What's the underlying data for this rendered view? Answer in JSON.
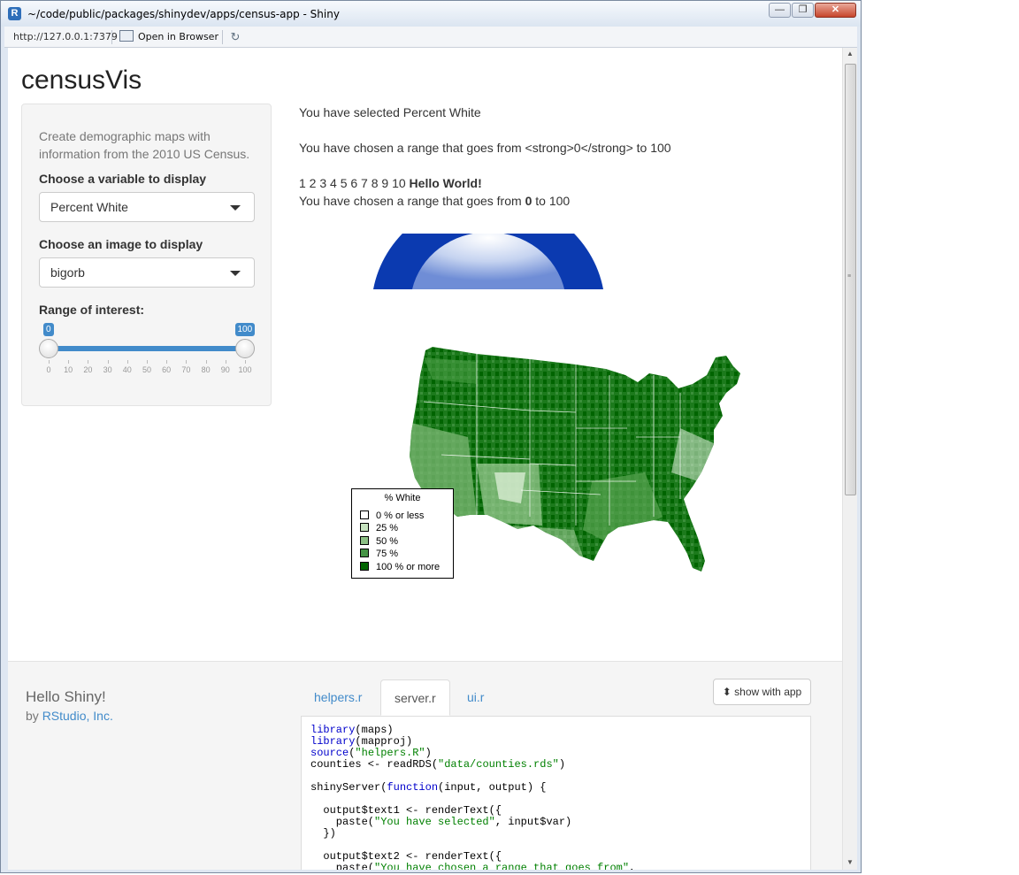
{
  "window": {
    "title": "~/code/public/packages/shinydev/apps/census-app - Shiny",
    "logo_letter": "R",
    "minimize_glyph": "—",
    "maximize_glyph": "❐",
    "close_glyph": "✕"
  },
  "toolbar": {
    "url": "http://127.0.0.1:7379",
    "open_in_browser": "Open in Browser",
    "reload_glyph": "↻"
  },
  "app": {
    "title": "censusVis",
    "help_text": "Create demographic maps with information from the 2010 US Census.",
    "variable_label": "Choose a variable to display",
    "variable_value": "Percent White",
    "image_label": "Choose an image to display",
    "image_value": "bigorb",
    "range_label": "Range of interest:",
    "slider": {
      "min": 0,
      "max": 100,
      "low": 0,
      "high": 100,
      "low_label": "0",
      "high_label": "100",
      "ticks": [
        "0",
        "10",
        "20",
        "30",
        "40",
        "50",
        "60",
        "70",
        "80",
        "90",
        "100"
      ]
    }
  },
  "main": {
    "text1": "You have selected Percent White",
    "text2": "You have chosen a range that goes from <strong>0</strong> to 100",
    "numbers": "1 2 3 4 5 6 7 8 9 10",
    "hello": "Hello World!",
    "range_prefix": "You have chosen a range that goes from",
    "range_low": "0",
    "range_mid": "to 100"
  },
  "legend": {
    "title": "% White",
    "items": [
      {
        "label": "0 % or less",
        "color": "#ffffff"
      },
      {
        "label": "25 %",
        "color": "#c7e3c0"
      },
      {
        "label": "50 %",
        "color": "#8cc085"
      },
      {
        "label": "75 %",
        "color": "#459445"
      },
      {
        "label": "100 % or more",
        "color": "#006400"
      }
    ]
  },
  "showcase": {
    "title": "Hello Shiny!",
    "by": "by",
    "author": "RStudio, Inc.",
    "tabs": [
      "helpers.r",
      "server.r",
      "ui.r"
    ],
    "active_tab": "server.r",
    "show_app": "show with app",
    "show_app_glyph": "⬍"
  },
  "colors": {
    "accent": "#428bca",
    "orb_ring": "#0b3ab0",
    "map_green": "#1c7a1c",
    "map_dark": "#006400"
  }
}
